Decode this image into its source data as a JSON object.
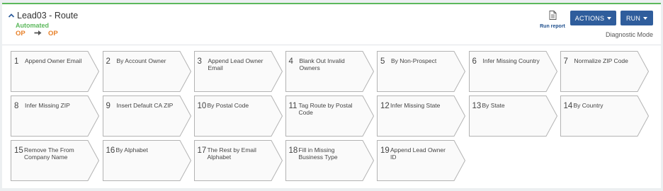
{
  "header": {
    "title": "Lead03 - Route",
    "status": "Automated",
    "trail_from": "OP",
    "trail_to": "OP",
    "run_report_label": "Run report",
    "actions_label": "ACTIONS",
    "run_label": "RUN",
    "mode_label": "Diagnostic Mode"
  },
  "colors": {
    "accent_green": "#5cb85c",
    "button_blue": "#2f5d9c",
    "op_orange": "#e8812a",
    "op_purple": "#6b4ca3"
  },
  "steps": [
    {
      "num": "1",
      "label": "Append Owner Email"
    },
    {
      "num": "2",
      "label": "By Account Owner"
    },
    {
      "num": "3",
      "label": "Append Lead Owner Email"
    },
    {
      "num": "4",
      "label": "Blank Out Invalid Owners"
    },
    {
      "num": "5",
      "label": "By Non-Prospect"
    },
    {
      "num": "6",
      "label": "Infer Missing Country"
    },
    {
      "num": "7",
      "label": "Normalize ZIP Code"
    },
    {
      "num": "8",
      "label": "Infer Missing ZIP"
    },
    {
      "num": "9",
      "label": "Insert Default CA ZIP"
    },
    {
      "num": "10",
      "label": "By Postal Code"
    },
    {
      "num": "11",
      "label": "Tag Route by Postal Code"
    },
    {
      "num": "12",
      "label": "Infer Missing State"
    },
    {
      "num": "13",
      "label": "By State"
    },
    {
      "num": "14",
      "label": "By Country"
    },
    {
      "num": "15",
      "label": "Remove The From Company Name"
    },
    {
      "num": "16",
      "label": "By Alphabet"
    },
    {
      "num": "17",
      "label": "The Rest by Email Alphabet"
    },
    {
      "num": "18",
      "label": "Fill in Missing Business Type"
    },
    {
      "num": "19",
      "label": "Append Lead Owner ID"
    }
  ]
}
